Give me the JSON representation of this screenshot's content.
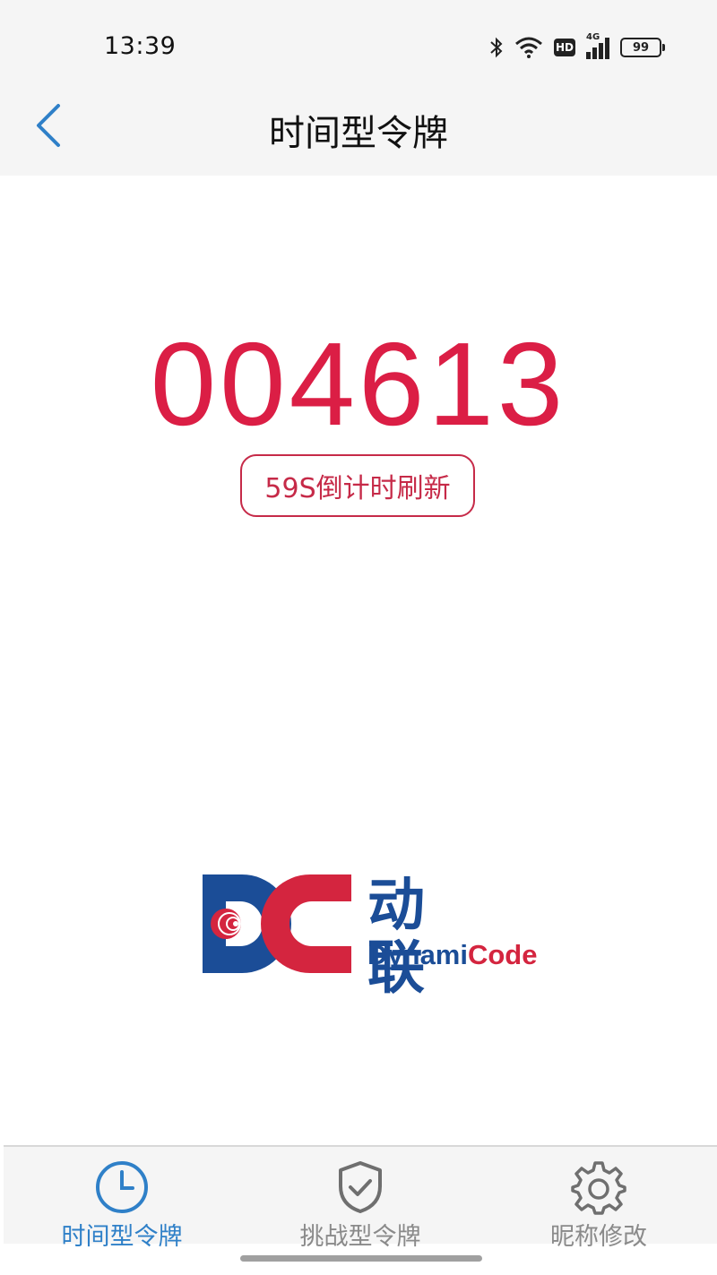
{
  "status_bar": {
    "time": "13:39",
    "hd_label": "HD",
    "network_label": "4G",
    "battery_level": "99",
    "icons": [
      "bluetooth-icon",
      "wifi-icon",
      "hd-icon",
      "signal-icon",
      "battery-icon"
    ]
  },
  "nav": {
    "title": "时间型令牌",
    "back_icon": "chevron-left-icon"
  },
  "token": {
    "code": "004613",
    "countdown_label": "59S倒计时刷新",
    "code_color": "#db1e45"
  },
  "logo": {
    "cn_text": "动 联",
    "en_main": "Dynami",
    "en_accent": "Code",
    "primary_color": "#1b4d97",
    "accent_color": "#d4253f"
  },
  "tabs": [
    {
      "label": "时间型令牌",
      "icon": "clock-icon",
      "active": true
    },
    {
      "label": "挑战型令牌",
      "icon": "shield-check-icon",
      "active": false
    },
    {
      "label": "昵称修改",
      "icon": "gear-icon",
      "active": false
    }
  ],
  "colors": {
    "active_tab": "#2f80c8",
    "inactive_tab": "#8a8a8a",
    "bar_background": "#f5f5f5"
  }
}
